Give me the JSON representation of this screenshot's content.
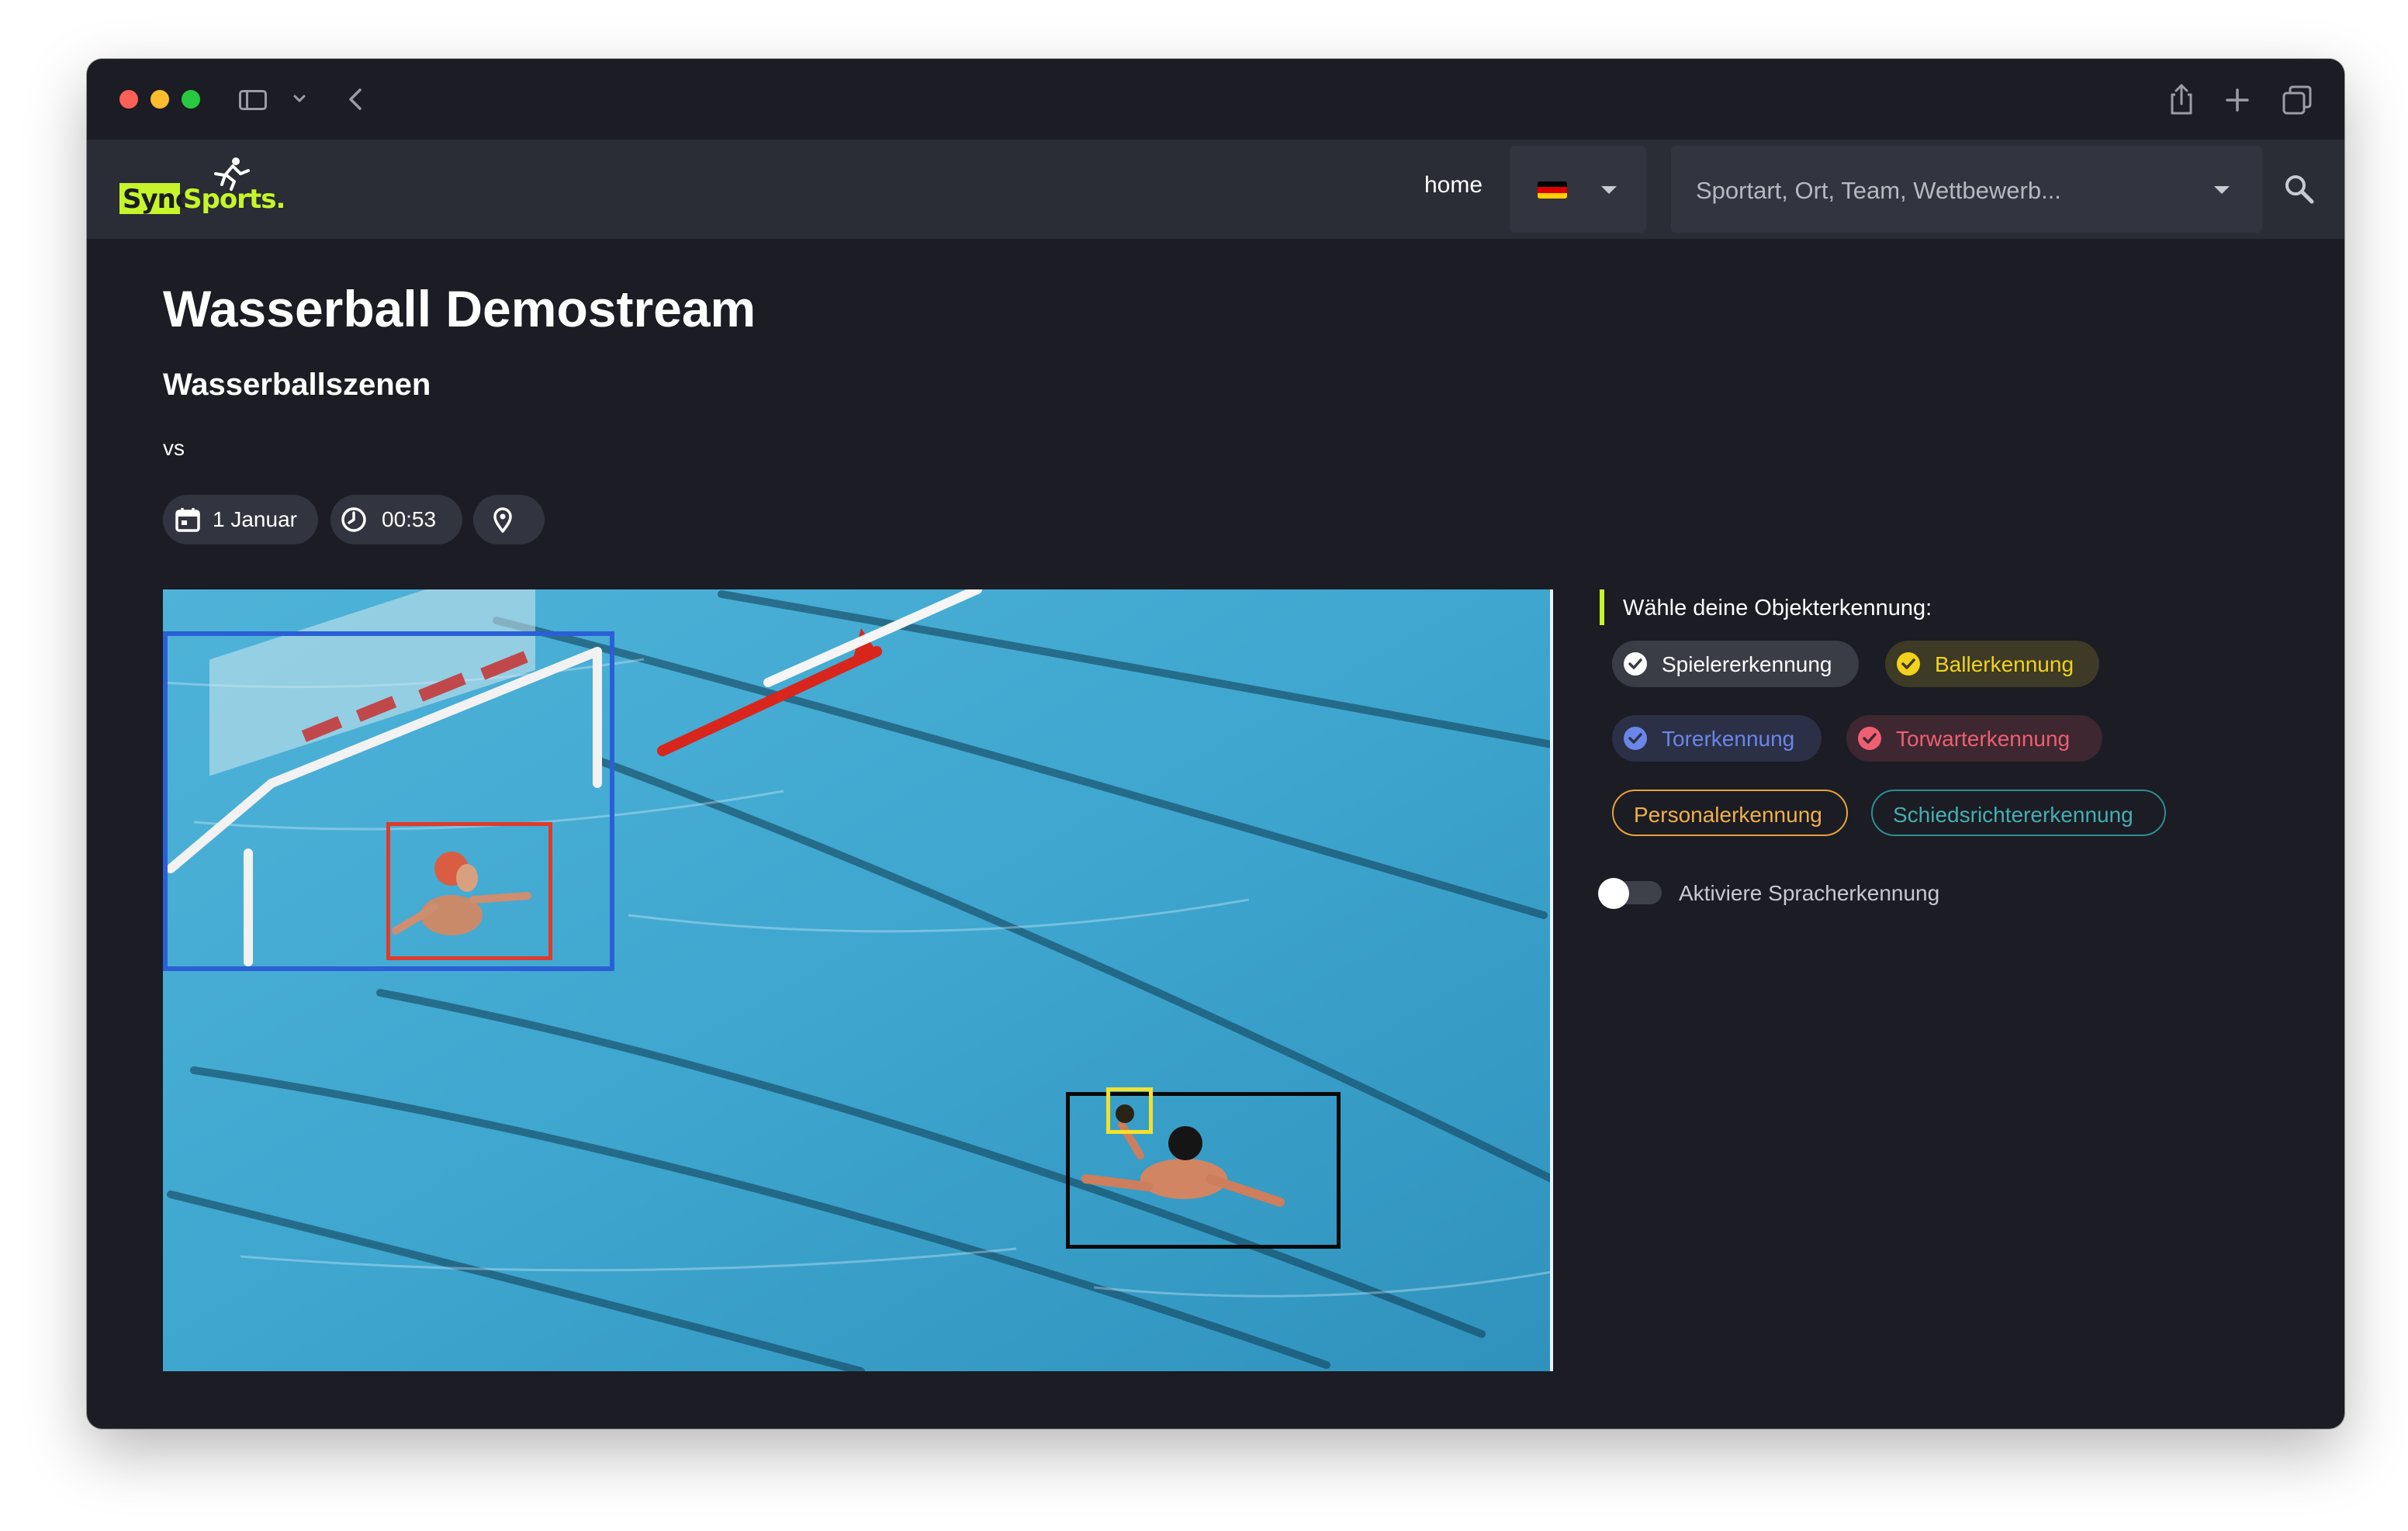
{
  "browser": {
    "icons": [
      "sidebar-toggle-icon",
      "chevron-down-icon",
      "back-chevron-icon",
      "share-icon",
      "plus-icon",
      "tabs-overview-icon"
    ]
  },
  "navbar": {
    "logo": "SyncSports.",
    "home_label": "home",
    "language": {
      "flag": "germany-flag",
      "colors": [
        "#000000",
        "#dd0000",
        "#ffce00"
      ]
    },
    "search_placeholder": "Sportart, Ort, Team, Wettbewerb..."
  },
  "event": {
    "title": "Wasserball Demostream",
    "subtitle": "Wasserballszenen",
    "vs": "vs",
    "date": "1 Januar",
    "time": "00:53",
    "location": ""
  },
  "video": {
    "description_icons": [
      "goal-detection-box",
      "goalkeeper-detection-box",
      "player-detection-box",
      "ball-detection-box"
    ],
    "colors": {
      "goal": "#2a5fd6",
      "keeper": "#e03a2a",
      "player": "#0a0a0a",
      "ball": "#f3e12b"
    }
  },
  "detection": {
    "heading": "Wähle deine Objekterkennung:",
    "chips": [
      {
        "label": "Spielererkennung",
        "active": true,
        "color": "#ffffff"
      },
      {
        "label": "Ballerkennung",
        "active": true,
        "color": "#f2d21c"
      },
      {
        "label": "Torerkennung",
        "active": true,
        "color": "#6a86e8"
      },
      {
        "label": "Torwarterkennung",
        "active": true,
        "color": "#ee5f72"
      },
      {
        "label": "Personalerkennung",
        "active": false,
        "color": "#f1b04a"
      },
      {
        "label": "Schiedsrichtererkennung",
        "active": false,
        "color": "#46aeb0"
      }
    ],
    "speech_toggle_label": "Aktiviere Spracherkennung",
    "speech_toggle_on": false
  },
  "accent": "#c5f52a"
}
